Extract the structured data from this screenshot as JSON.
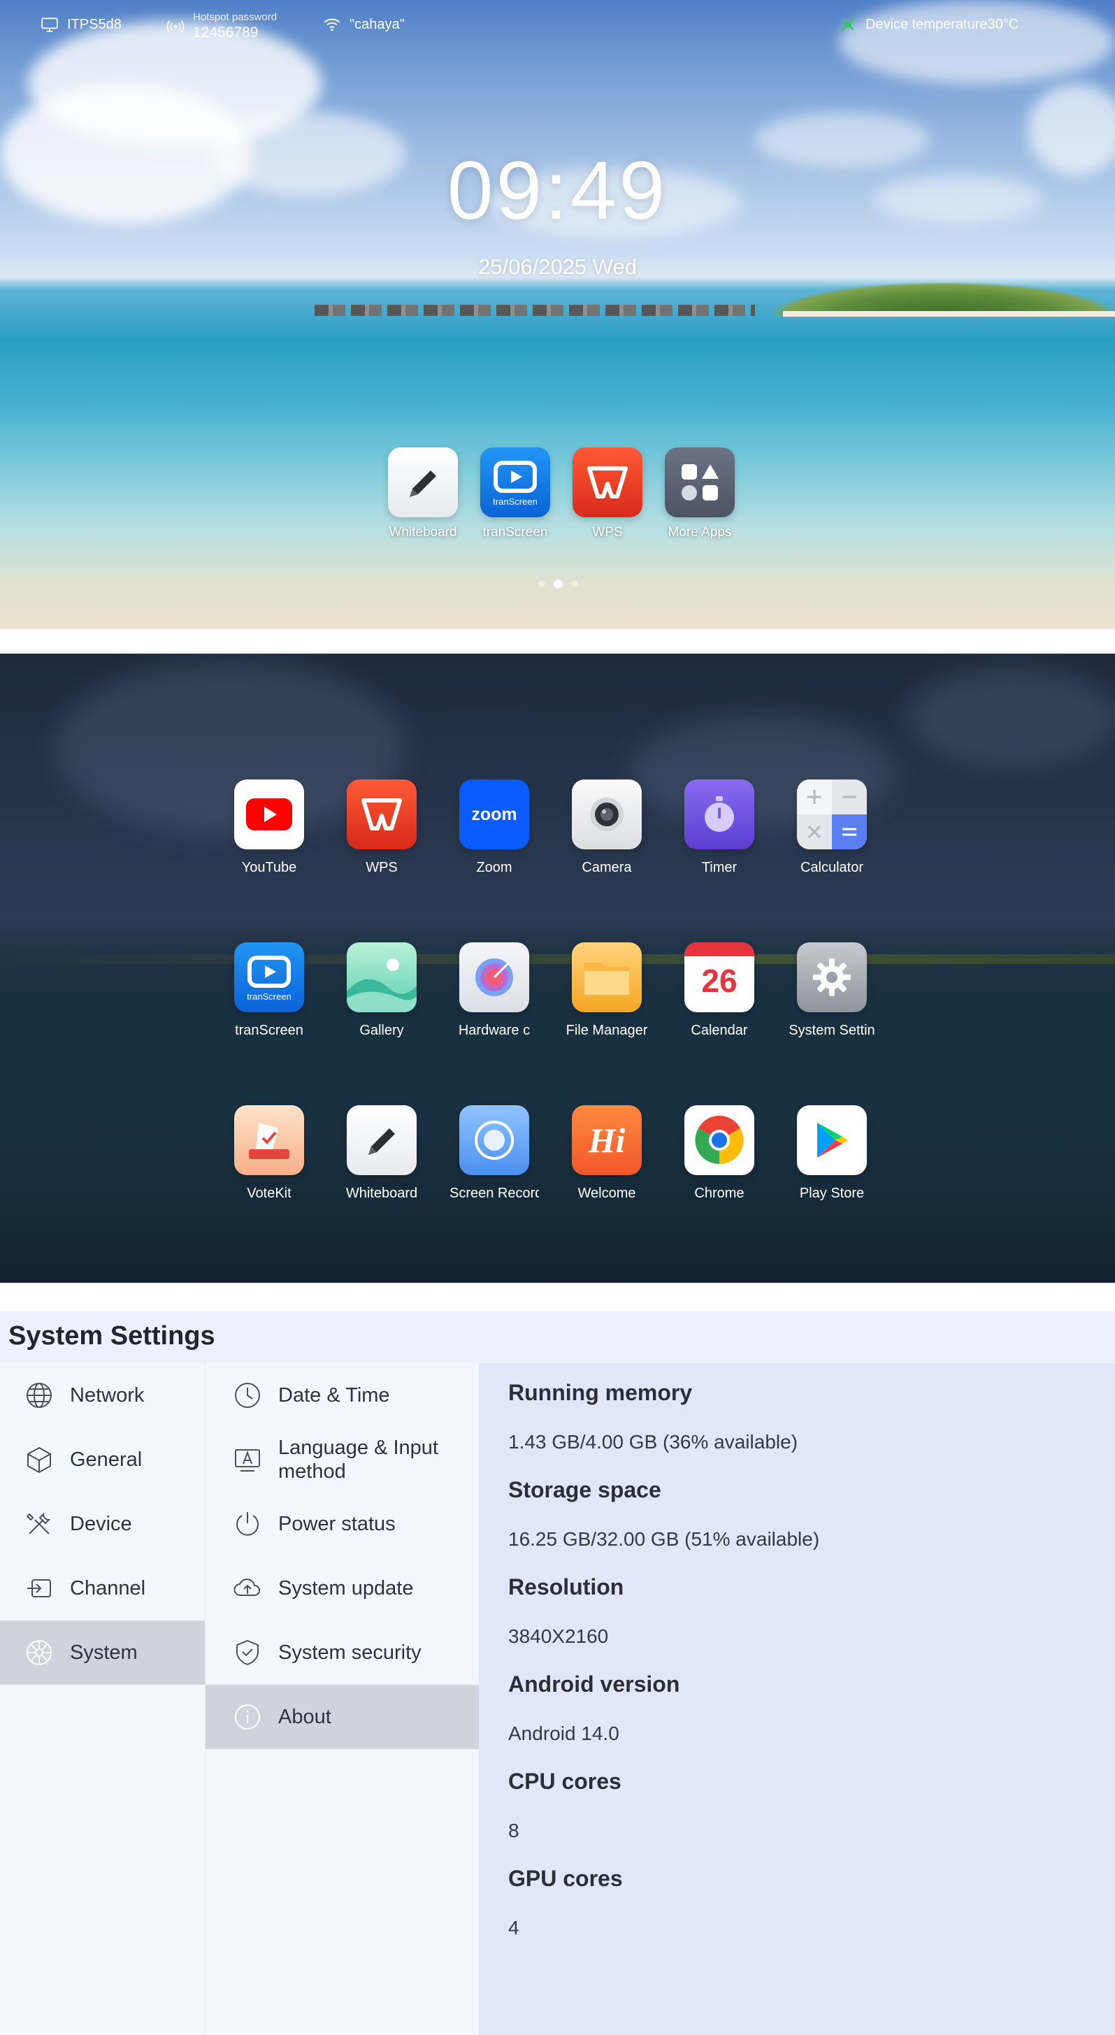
{
  "status_bar": {
    "network_name": "ITPS5d8",
    "hotspot_label": "Hotspot password",
    "hotspot_password": "12456789",
    "wifi_name": "\"cahaya\"",
    "device_temperature": "Device temperature30°C"
  },
  "home": {
    "time": "09:49",
    "date": "25/06/2025 Wed",
    "dock": [
      {
        "label": "Whiteboard",
        "icon": "pen-icon"
      },
      {
        "label": "tranScreen",
        "icon": "transcreen-icon"
      },
      {
        "label": "WPS",
        "icon": "wps-icon"
      },
      {
        "label": "More Apps",
        "icon": "apps-grid-icon"
      }
    ],
    "page_count": 3,
    "active_page": 2
  },
  "drawer": {
    "apps": [
      {
        "label": "YouTube"
      },
      {
        "label": "WPS"
      },
      {
        "label": "Zoom"
      },
      {
        "label": "Camera"
      },
      {
        "label": "Timer"
      },
      {
        "label": "Calculator"
      },
      {
        "label": "tranScreen"
      },
      {
        "label": "Gallery"
      },
      {
        "label": "Hardware c"
      },
      {
        "label": "File Manager"
      },
      {
        "label": "Calendar"
      },
      {
        "label": "System Settin"
      },
      {
        "label": "VoteKit"
      },
      {
        "label": "Whiteboard"
      },
      {
        "label": "Screen Record"
      },
      {
        "label": "Welcome"
      },
      {
        "label": "Chrome"
      },
      {
        "label": "Play Store"
      }
    ],
    "zoom_text": "zoom",
    "calendar_day": "26",
    "welcome_text": "Hi",
    "transcreen_text": "tranScreen"
  },
  "settings": {
    "title": "System Settings",
    "level1": [
      "Network",
      "General",
      "Device",
      "Channel",
      "System"
    ],
    "level1_selected": "System",
    "level2": [
      "Date & Time",
      "Language & Input method",
      "Power status",
      "System update",
      "System security",
      "About"
    ],
    "level2_selected": "About",
    "about": [
      {
        "title": "Running memory",
        "value": "1.43 GB/4.00 GB (36% available)"
      },
      {
        "title": "Storage space",
        "value": "16.25 GB/32.00 GB (51% available)"
      },
      {
        "title": "Resolution",
        "value": "3840X2160"
      },
      {
        "title": "Android version",
        "value": "Android 14.0"
      },
      {
        "title": "CPU cores",
        "value": "8"
      },
      {
        "title": "GPU cores",
        "value": "4"
      }
    ]
  },
  "colors": {
    "accent_blue": "#1a73e8",
    "wps_red": "#e8412c",
    "settings_bg": "#dfe7f8",
    "selected_bg": "#cfd3db"
  }
}
